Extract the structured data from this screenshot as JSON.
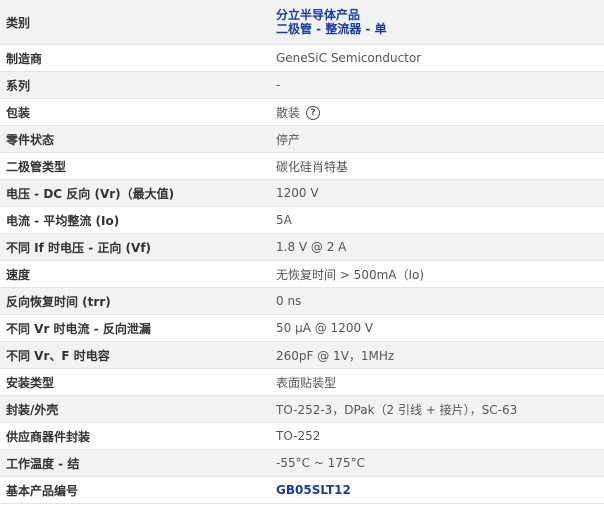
{
  "specs": {
    "category": {
      "label": "类别",
      "link1": "分立半导体产品",
      "link2": "二极管 - 整流器 - 单"
    },
    "rows": [
      {
        "label": "制造商",
        "value": "GeneSiC Semiconductor"
      },
      {
        "label": "系列",
        "value": "-"
      },
      {
        "label": "包装",
        "value": "散装"
      },
      {
        "label": "零件状态",
        "value": "停产"
      },
      {
        "label": "二极管类型",
        "value": "碳化硅肖特基"
      },
      {
        "label": "电压 - DC 反向 (Vr)（最大值)",
        "value": "1200 V"
      },
      {
        "label": "电流 - 平均整流 (Io)",
        "value": "5A"
      },
      {
        "label": "不同 If 时电压 - 正向 (Vf)",
        "value": "1.8 V @ 2 A"
      },
      {
        "label": "速度",
        "value": "无恢复时间 > 500mA（Io)"
      },
      {
        "label": "反向恢复时间 (trr)",
        "value": "0 ns"
      },
      {
        "label": "不同 Vr 时电流 - 反向泄漏",
        "value": "50 µA @ 1200 V"
      },
      {
        "label": "不同 Vr、F 时电容",
        "value": "260pF @ 1V，1MHz"
      },
      {
        "label": "安装类型",
        "value": "表面贴装型"
      },
      {
        "label": "封装/外壳",
        "value": "TO-252-3，DPak（2 引线 + 接片），SC-63"
      },
      {
        "label": "供应商器件封装",
        "value": "TO-252"
      },
      {
        "label": "工作温度 - 结",
        "value": "-55°C ~ 175°C"
      },
      {
        "label": "基本产品编号",
        "value": "GB05SLT12"
      }
    ],
    "help_icon_glyph": "?"
  }
}
